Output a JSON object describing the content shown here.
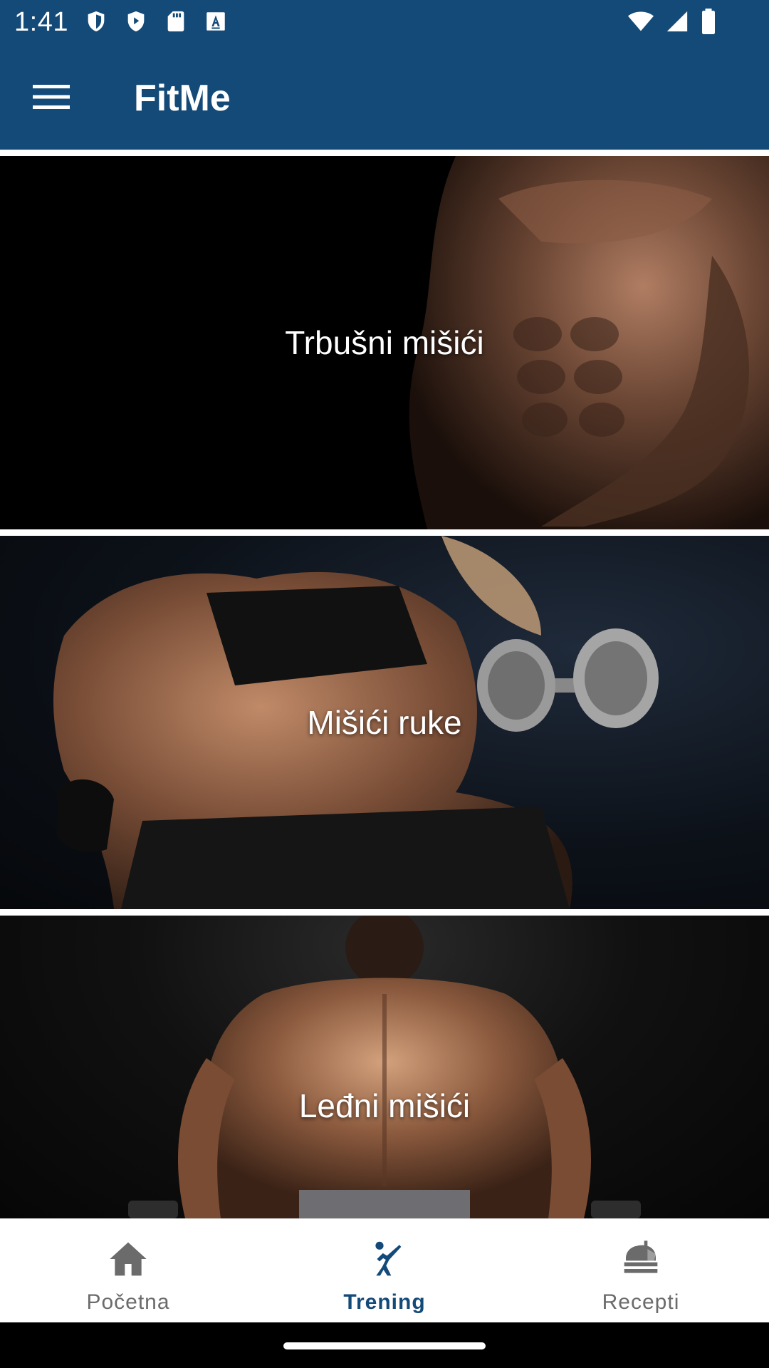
{
  "status_bar": {
    "time": "1:41",
    "left_icons": [
      "vpn-shield-icon",
      "play-protect-icon",
      "sd-card-icon",
      "font-a-icon"
    ],
    "right_icons": [
      "wifi-icon",
      "signal-icon",
      "battery-icon"
    ]
  },
  "app_bar": {
    "title": "FitMe",
    "menu_icon": "hamburger-menu-icon",
    "background": "#144a78"
  },
  "cards": [
    {
      "label": "Trbušni mišići",
      "image": "abs-photo"
    },
    {
      "label": "Mišići ruke",
      "image": "arm-dumbbell-photo"
    },
    {
      "label": "Leđni mišići",
      "image": "back-muscles-photo"
    }
  ],
  "bottom_nav": {
    "items": [
      {
        "label": "Početna",
        "icon": "home-icon",
        "active": false
      },
      {
        "label": "Trening",
        "icon": "martial-arts-kick-icon",
        "active": true
      },
      {
        "label": "Recepti",
        "icon": "food-tray-icon",
        "active": false
      }
    ],
    "active_color": "#144a78",
    "inactive_color": "#6b6b6b"
  }
}
